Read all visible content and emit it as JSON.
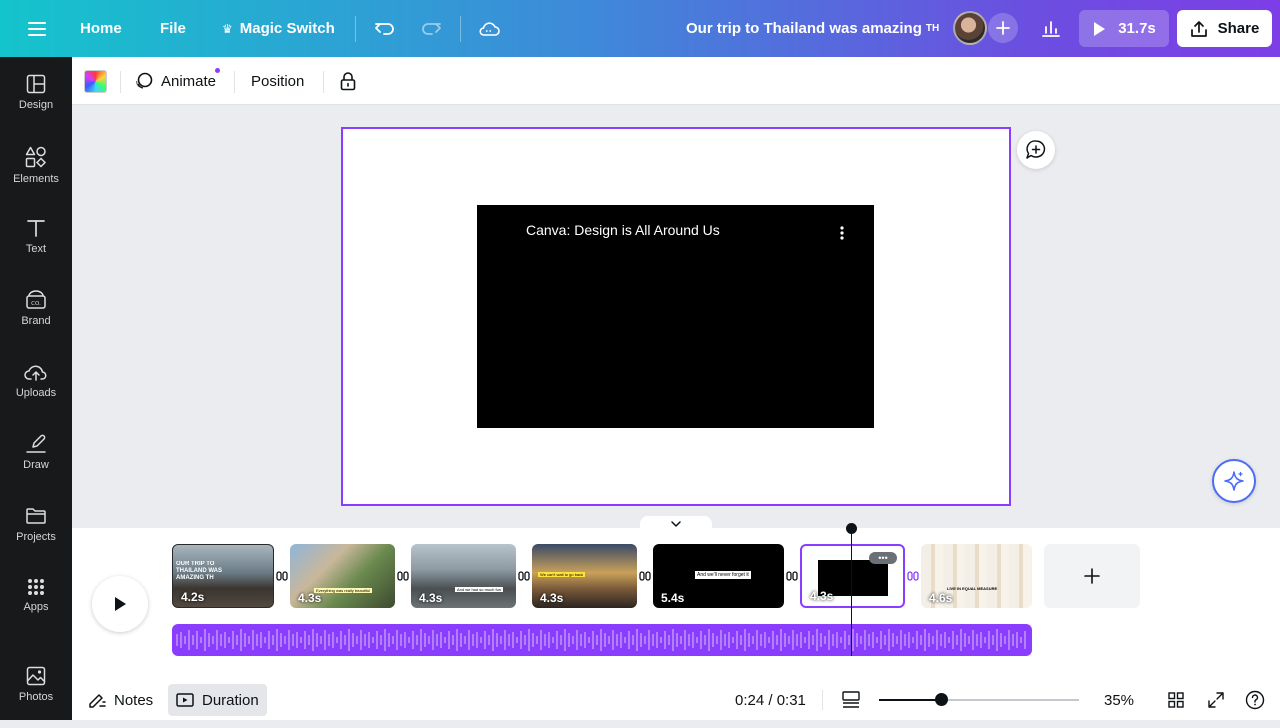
{
  "topbar": {
    "home": "Home",
    "file": "File",
    "magic_switch": "Magic Switch",
    "title": "Our trip to Thailand was amazing",
    "title_suffix": "TH",
    "play_duration": "31.7s",
    "share": "Share"
  },
  "sidebar": {
    "items": [
      {
        "label": "Design",
        "icon": "design-icon"
      },
      {
        "label": "Elements",
        "icon": "elements-icon"
      },
      {
        "label": "Text",
        "icon": "text-icon"
      },
      {
        "label": "Brand",
        "icon": "brand-icon"
      },
      {
        "label": "Uploads",
        "icon": "uploads-icon"
      },
      {
        "label": "Draw",
        "icon": "draw-icon"
      },
      {
        "label": "Projects",
        "icon": "projects-icon"
      },
      {
        "label": "Apps",
        "icon": "apps-icon"
      },
      {
        "label": "Photos",
        "icon": "photos-icon"
      }
    ]
  },
  "toolbar": {
    "animate": "Animate",
    "position": "Position"
  },
  "video": {
    "title": "Canva: Design is All Around Us"
  },
  "timeline": {
    "clips": [
      {
        "duration": "4.2s",
        "caption": "OUR TRIP TO THAILAND WAS AMAZING TH"
      },
      {
        "duration": "4.3s",
        "caption": "Everything was really beautiful"
      },
      {
        "duration": "4.3s",
        "caption": "And we had so much fun"
      },
      {
        "duration": "4.3s",
        "caption": "We can't wait to go back"
      },
      {
        "duration": "5.4s",
        "caption": "And we'll never forget it"
      },
      {
        "duration": "4.3s",
        "caption": ""
      },
      {
        "duration": "4.6s",
        "caption": "LIVE IN EQUAL MEASURE"
      }
    ]
  },
  "footer": {
    "notes": "Notes",
    "duration": "Duration",
    "time": "0:24 / 0:31",
    "zoom": "35%",
    "zoom_fraction": 0.31
  },
  "colors": {
    "accent": "#8b3dff",
    "sidebar_bg": "#18191b"
  }
}
